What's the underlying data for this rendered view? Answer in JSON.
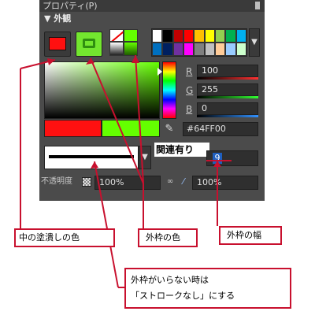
{
  "window": {
    "title": "プロパティ(P)"
  },
  "section": {
    "title": "外観"
  },
  "colors": {
    "fill": "#ff1010",
    "stroke": "#64ff00",
    "panel_bg": "#4b4b4b",
    "callout_border": "#c8102e"
  },
  "palette": [
    "#ffffff",
    "#000000",
    "#c00000",
    "#ff0000",
    "#ffc000",
    "#ffff00",
    "#92d050",
    "#00b050",
    "#00b0f0",
    "#0070c0",
    "#002060",
    "#7030a0",
    "#ff00ff",
    "#808080",
    "#c0c0c0",
    "#ffcc99",
    "#99ccff",
    "#ccffcc"
  ],
  "rgb": [
    {
      "label": "R",
      "value": "100",
      "bar": "#ff3030"
    },
    {
      "label": "G",
      "value": "255",
      "bar": "#30ff30"
    },
    {
      "label": "B",
      "value": "0",
      "bar": "#3090ff"
    }
  ],
  "hex": "#64FF00",
  "stroke": {
    "linked_label": "関連有り",
    "width": "9"
  },
  "opacity": {
    "label": "不透明度",
    "fill_value": "100%",
    "stroke_value": "100%"
  },
  "icons": {
    "hue_pointer": "triangle-pointer-icon",
    "eyedropper": "eyedropper-icon",
    "link": "link-icon",
    "brush": "brush-icon",
    "checker": "checkerboard-icon",
    "dropdown": "chevron-down-icon",
    "pin": "pin-icon"
  },
  "callouts": {
    "fill": "中の塗潰しの色",
    "stroke_color": "外枠の色",
    "stroke_width": "外枠の幅",
    "no_stroke_line1": "外枠がいらない時は",
    "no_stroke_line2": "「ストロークなし」にする"
  }
}
